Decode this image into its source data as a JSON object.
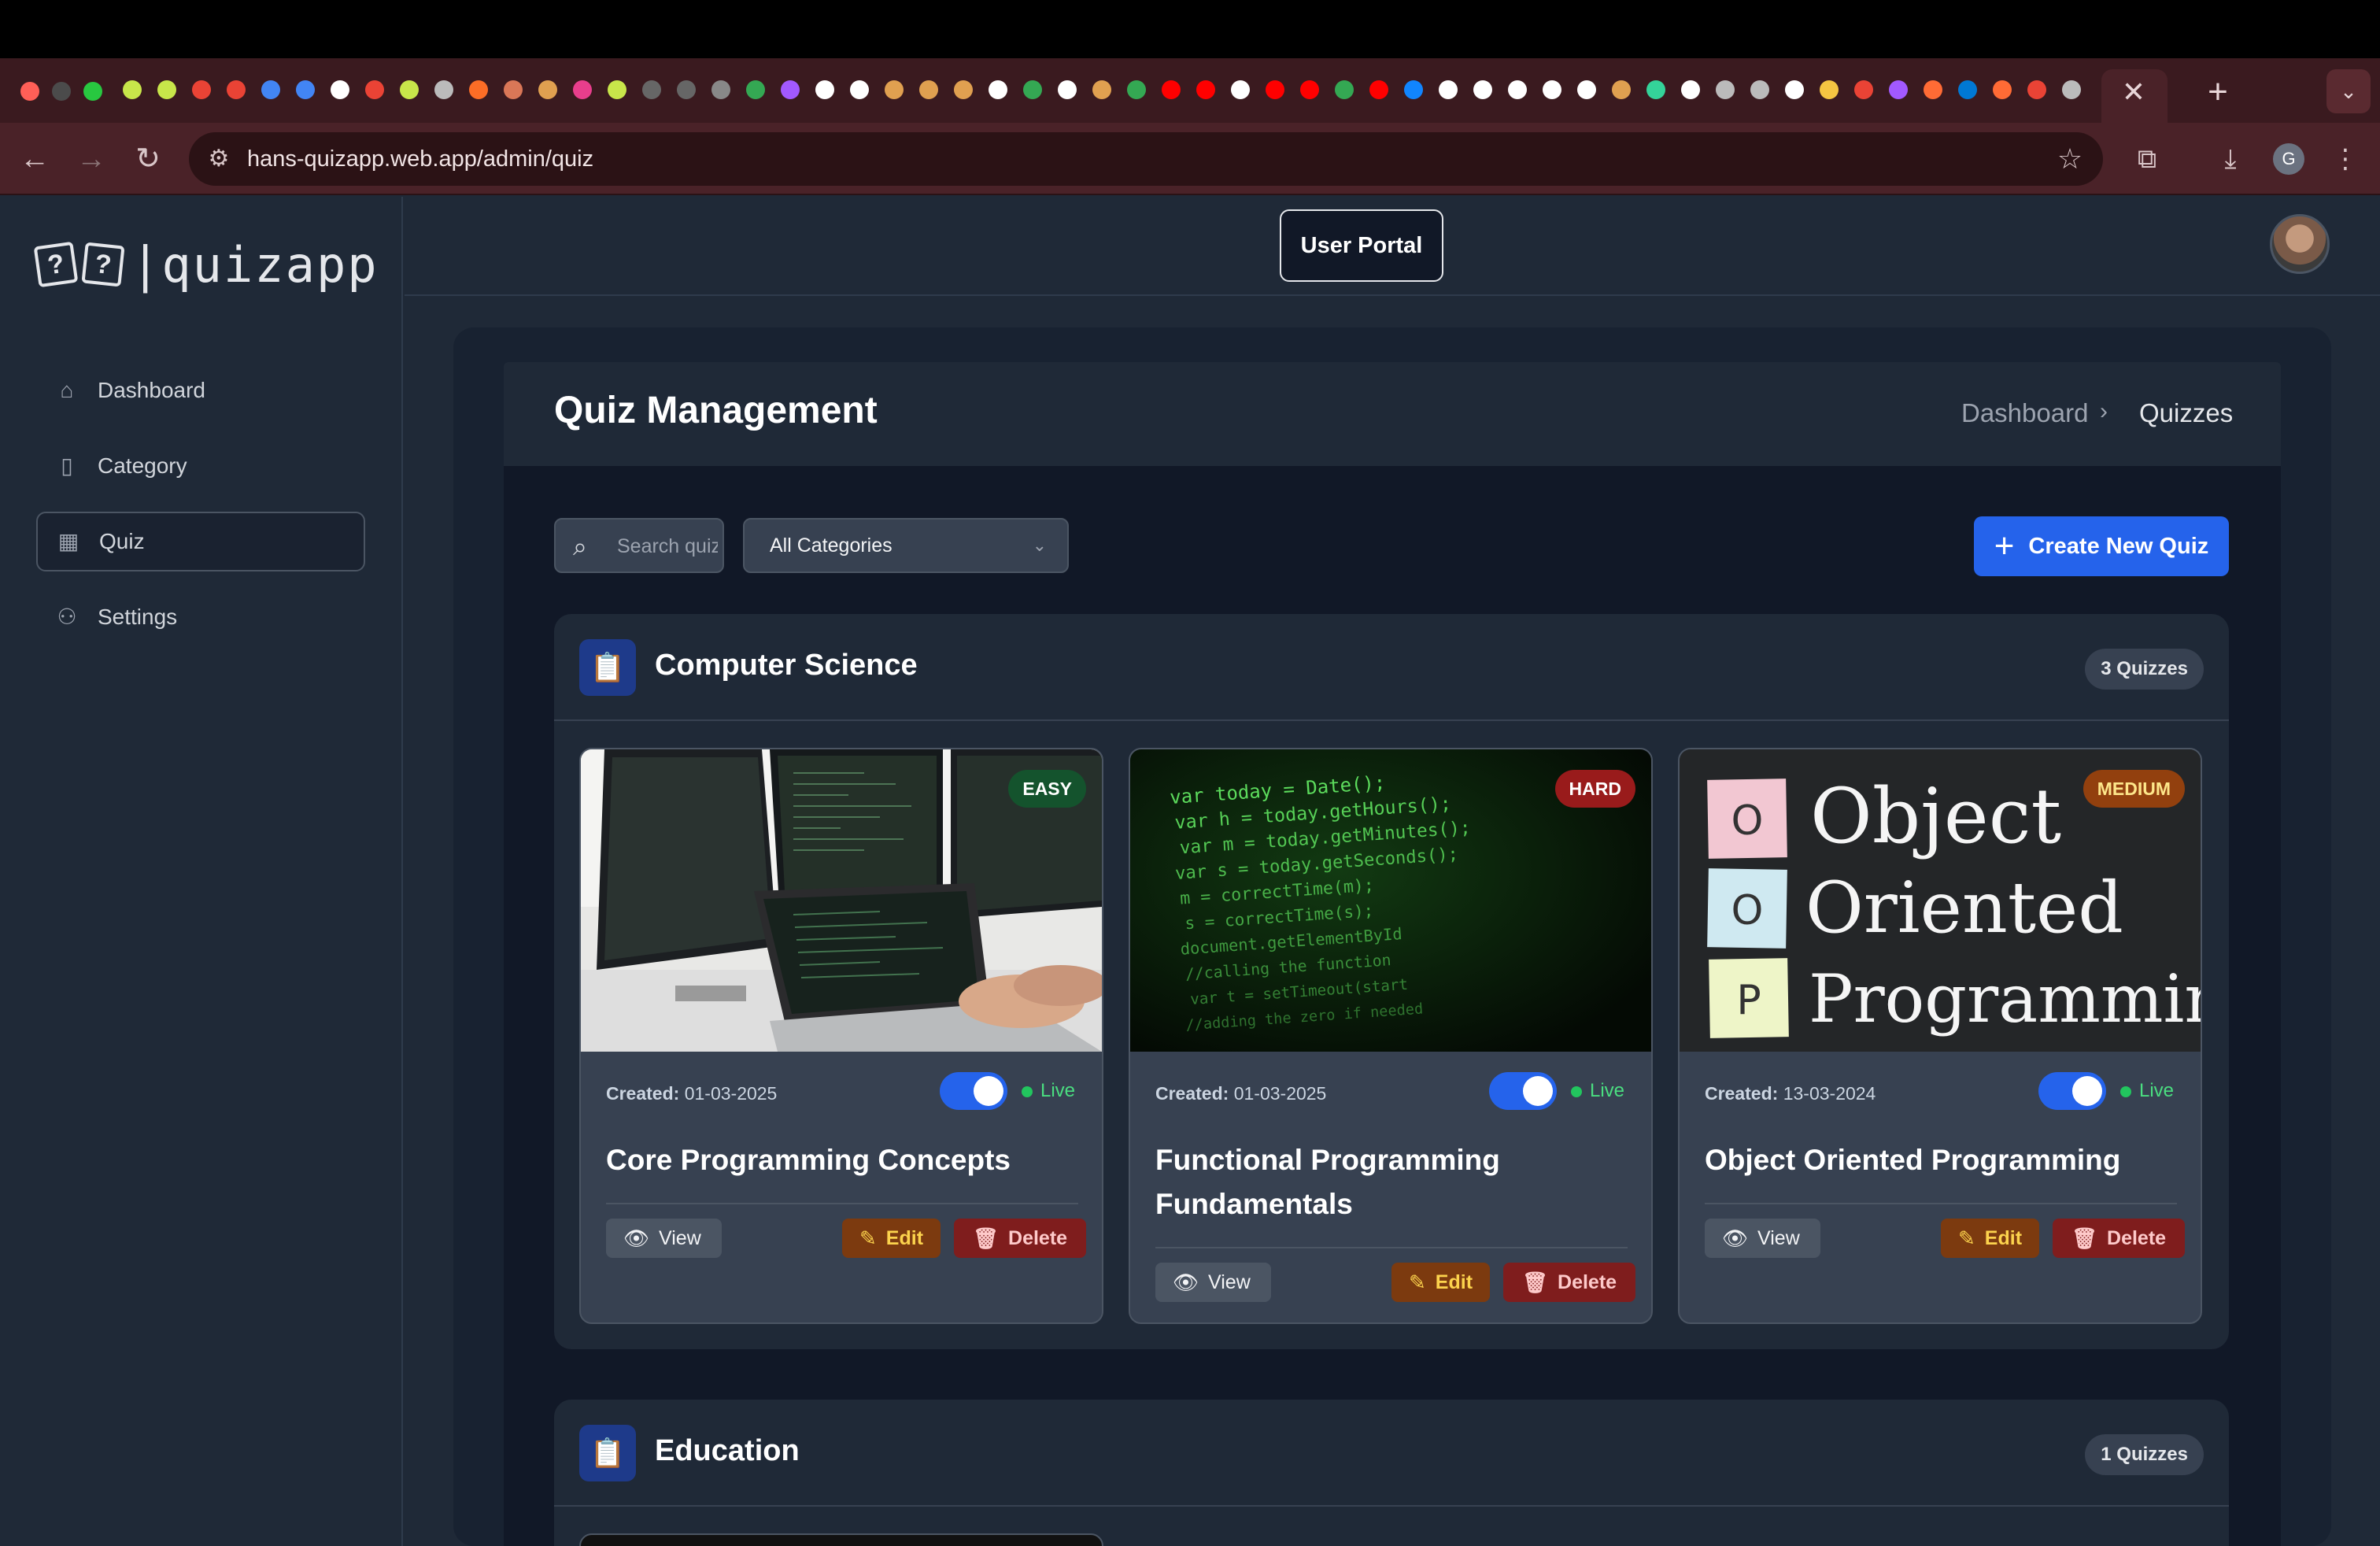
{
  "browser": {
    "url": "hans-quizapp.web.app/admin/quiz",
    "profile_initial": "G",
    "tab_close": "✕",
    "new_tab": "+"
  },
  "sidebar": {
    "logo_mark_1": "?",
    "logo_mark_2": "?",
    "logo_text": "|quizapp",
    "items": [
      {
        "label": "Dashboard",
        "icon": "home-icon"
      },
      {
        "label": "Category",
        "icon": "book-icon"
      },
      {
        "label": "Quiz",
        "icon": "calendar-icon"
      },
      {
        "label": "Settings",
        "icon": "user-settings-icon"
      }
    ]
  },
  "topbar": {
    "user_portal": "User Portal"
  },
  "page": {
    "title": "Quiz Management",
    "breadcrumb": [
      "Dashboard",
      "Quizzes"
    ]
  },
  "filters": {
    "search_placeholder": "Search quizzes",
    "category_selected": "All Categories",
    "create_button": "Create New Quiz"
  },
  "categories": [
    {
      "name": "Computer Science",
      "count": "3 Quizzes",
      "quizzes": [
        {
          "difficulty": "EASY",
          "created_label": "Created:",
          "created": "01-03-2025",
          "live": true,
          "status": "Live",
          "title": "Core Programming Concepts",
          "actions": [
            "View",
            "Edit",
            "Delete"
          ]
        },
        {
          "difficulty": "HARD",
          "created_label": "Created:",
          "created": "01-03-2025",
          "live": true,
          "status": "Live",
          "title": "Functional Programming Fundamentals",
          "actions": [
            "View",
            "Edit",
            "Delete"
          ]
        },
        {
          "difficulty": "MEDIUM",
          "created_label": "Created:",
          "created": "13-03-2024",
          "live": true,
          "status": "Live",
          "title": "Object Oriented Programming",
          "actions": [
            "View",
            "Edit",
            "Delete"
          ]
        }
      ]
    },
    {
      "name": "Education",
      "count": "1 Quizzes"
    }
  ],
  "images": {
    "code_lines": [
      "var today = Date();",
      "var h = today.getHours();",
      "var m = today.getMinutes();",
      "var s = today.getSeconds();",
      "m = correctTime(m);",
      "s = correctTime(s);",
      "document.getElementById",
      "//calling the function",
      "var t = setTimeout(start",
      "//adding the zero if needed"
    ],
    "oop_letters": [
      "O",
      "O",
      "P"
    ],
    "oop_words": [
      "Object",
      "Oriented",
      "Programming"
    ]
  },
  "colors": {
    "accent": "#2563eb",
    "easy": "#14532d",
    "hard": "#991b1b",
    "medium": "#92400e",
    "live": "#22c55e"
  }
}
